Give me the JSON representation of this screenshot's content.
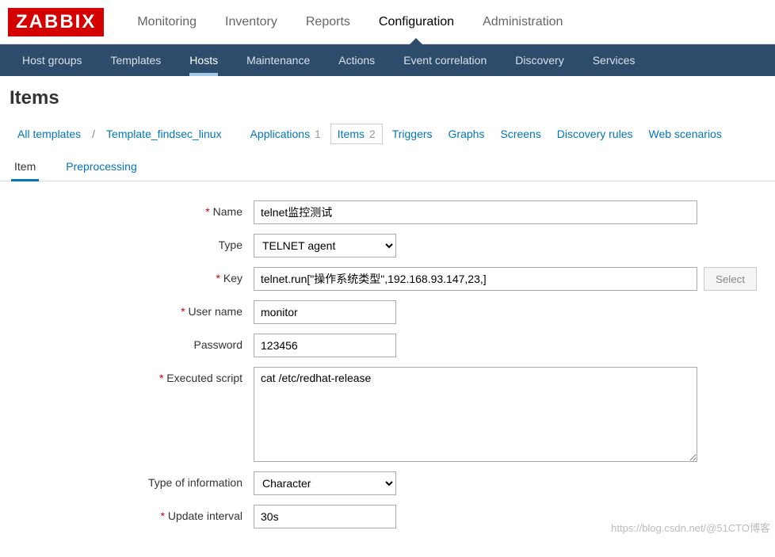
{
  "logo": "ZABBIX",
  "mainnav": {
    "monitoring": "Monitoring",
    "inventory": "Inventory",
    "reports": "Reports",
    "configuration": "Configuration",
    "administration": "Administration"
  },
  "subnav": {
    "hostgroups": "Host groups",
    "templates": "Templates",
    "hosts": "Hosts",
    "maintenance": "Maintenance",
    "actions": "Actions",
    "eventcorr": "Event correlation",
    "discovery": "Discovery",
    "services": "Services"
  },
  "pageTitle": "Items",
  "crumb": {
    "all": "All templates",
    "sep": "/",
    "template": "Template_findsec_linux",
    "applications": "Applications",
    "applicationsCount": "1",
    "items": "Items",
    "itemsCount": "2",
    "triggers": "Triggers",
    "graphs": "Graphs",
    "screens": "Screens",
    "discrules": "Discovery rules",
    "webscen": "Web scenarios"
  },
  "tabs": {
    "item": "Item",
    "preprocessing": "Preprocessing"
  },
  "form": {
    "labels": {
      "name": "Name",
      "type": "Type",
      "key": "Key",
      "username": "User name",
      "password": "Password",
      "script": "Executed script",
      "typeofinfo": "Type of information",
      "updint": "Update interval"
    },
    "values": {
      "name": "telnet监控测试",
      "type": "TELNET agent",
      "key": "telnet.run[\"操作系统类型\",192.168.93.147,23,]",
      "username": "monitor",
      "password": "123456",
      "script": "cat /etc/redhat-release",
      "typeofinfo": "Character",
      "updint": "30s"
    },
    "selectBtn": "Select"
  },
  "watermark": "https://blog.csdn.net/@51CTO博客"
}
